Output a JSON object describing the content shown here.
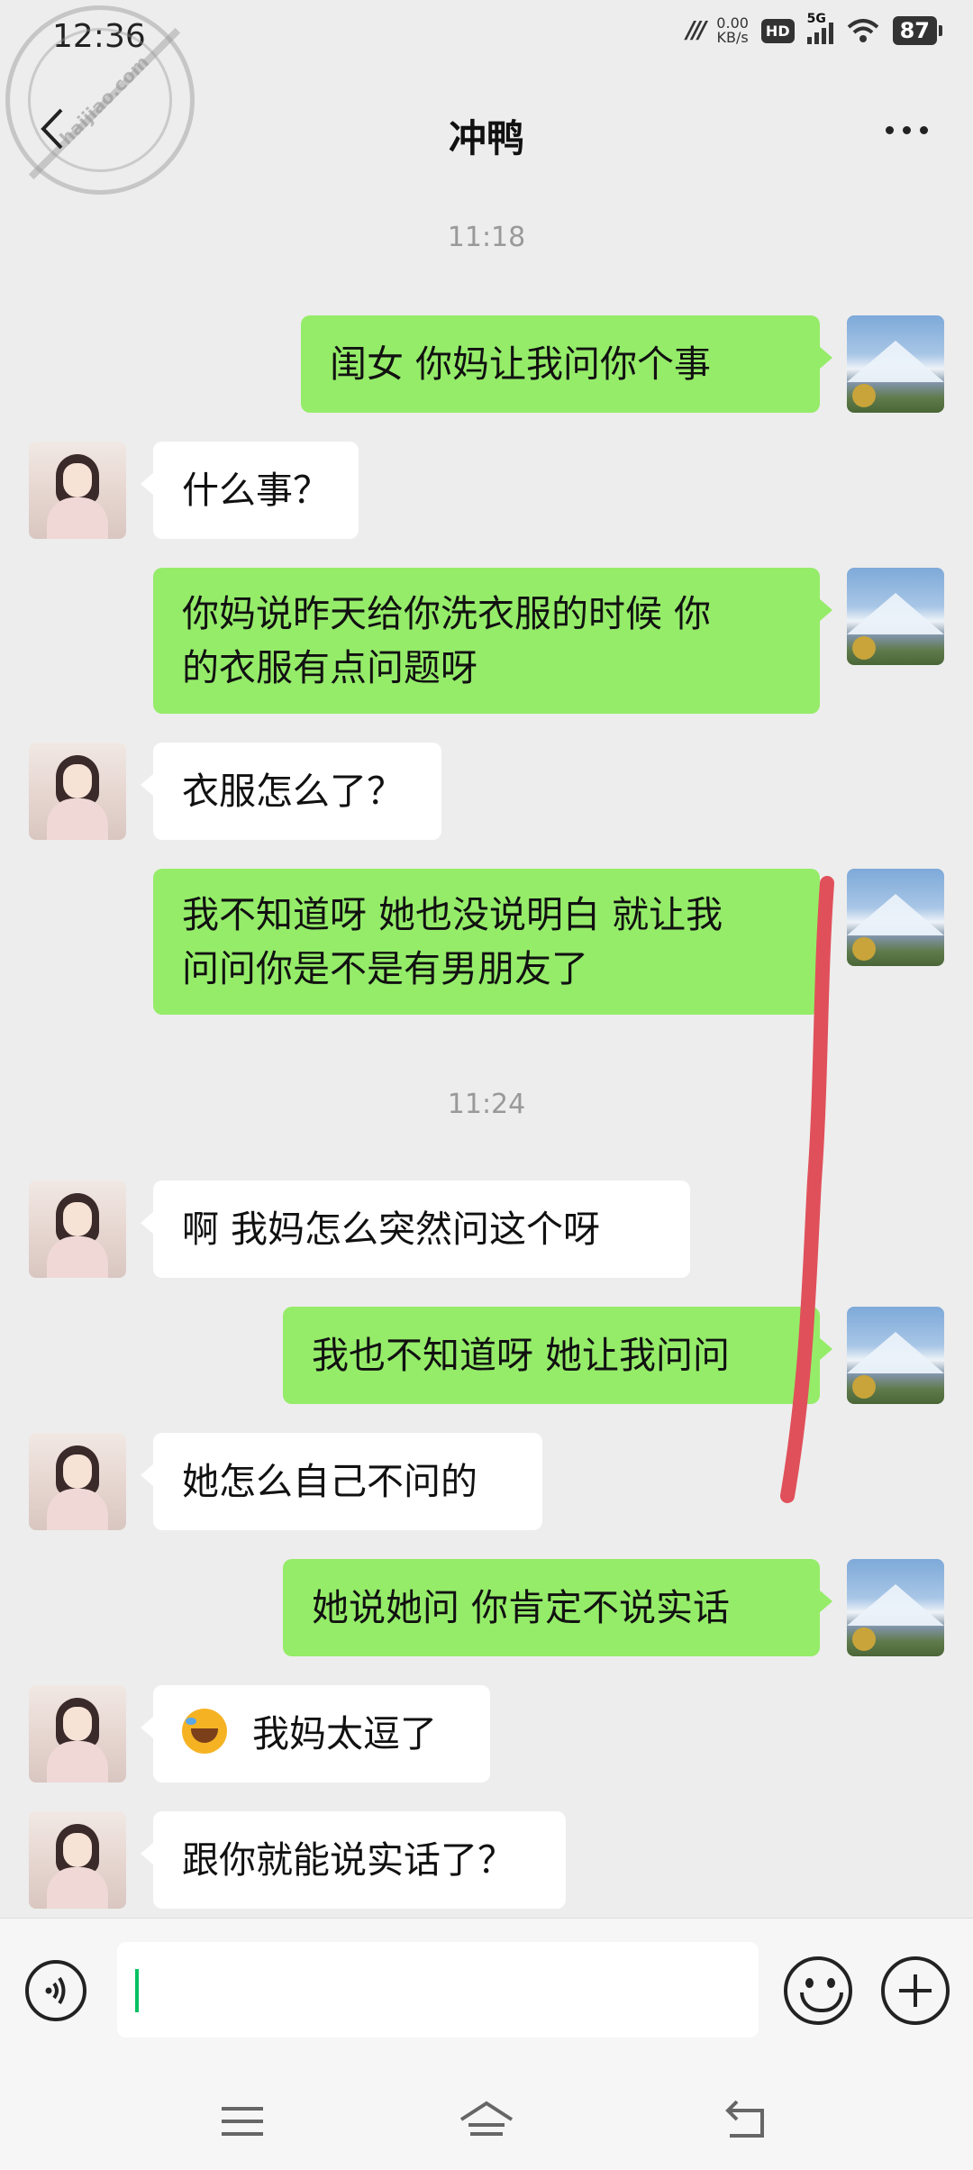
{
  "status_bar": {
    "time": "12:36",
    "network_icon": "signal-speed-icon",
    "speed_value": "0.00",
    "speed_unit": "KB/s",
    "hd_badge": "HD",
    "cell_label": "5G",
    "battery": "87"
  },
  "watermark": {
    "text": "haijiao.com"
  },
  "header": {
    "title": "冲鸭",
    "back_icon": "chevron-left-icon",
    "more_icon": "more-dots-icon"
  },
  "chat": {
    "timestamps": [
      "11:18",
      "11:24"
    ],
    "messages": [
      {
        "side": "right",
        "text": "闺女  你妈让我问你个事"
      },
      {
        "side": "left",
        "text": "什么事？"
      },
      {
        "side": "right",
        "lines": [
          "你妈说昨天给你洗衣服的时候  你",
          "的衣服有点问题呀"
        ]
      },
      {
        "side": "left",
        "text": "衣服怎么了？"
      },
      {
        "side": "right",
        "lines": [
          "我不知道呀  她也没说明白  就让我",
          "问问你是不是有男朋友了"
        ]
      },
      {
        "side": "left",
        "text": "啊  我妈怎么突然问这个呀"
      },
      {
        "side": "right",
        "text": "我也不知道呀  她让我问问"
      },
      {
        "side": "left",
        "text": "她怎么自己不问的"
      },
      {
        "side": "right",
        "text": "她说她问  你肯定不说实话"
      },
      {
        "side": "left",
        "text": "我妈太逗了",
        "emoji": "laughing-crying-face-icon"
      },
      {
        "side": "left",
        "text": "跟你就能说实话了？"
      }
    ],
    "annotation_color": "#e0505a"
  },
  "input_bar": {
    "voice_icon": "voice-icon",
    "field_value": "",
    "emoji_icon": "emoji-icon",
    "plus_icon": "plus-icon"
  },
  "system_nav": {
    "menu_icon": "menu-icon",
    "home_icon": "home-icon",
    "back_icon": "back-icon"
  },
  "colors": {
    "sent_bubble": "#95ec69",
    "received_bubble": "#ffffff",
    "background": "#ededed"
  }
}
